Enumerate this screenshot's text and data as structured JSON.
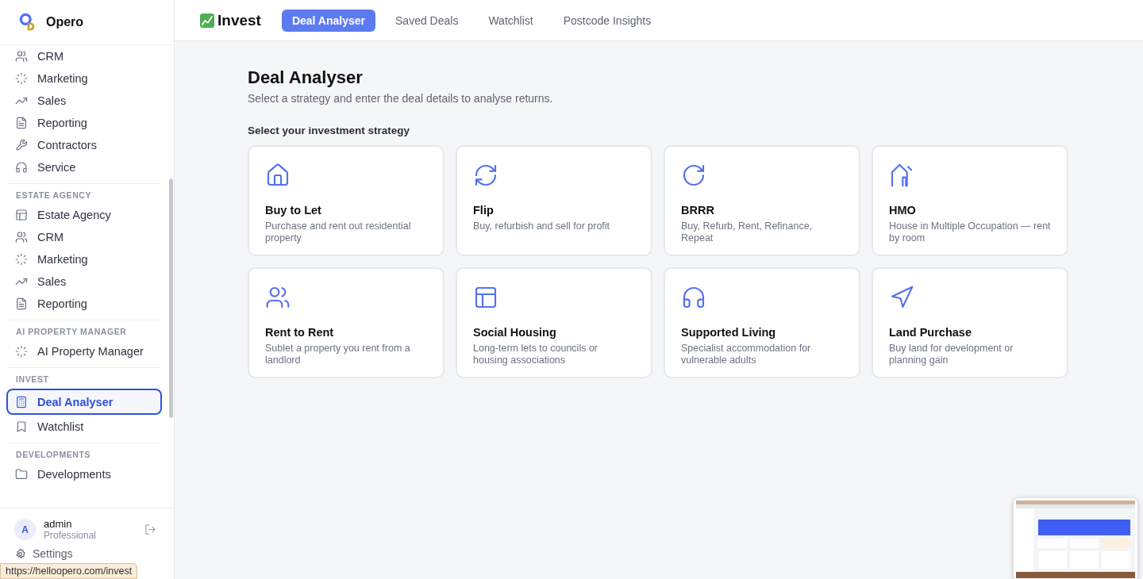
{
  "app": {
    "name": "Opero"
  },
  "sidebar": {
    "sections": [
      {
        "items": [
          {
            "label": "CRM",
            "selected": false
          },
          {
            "label": "Marketing",
            "selected": false
          },
          {
            "label": "Sales",
            "selected": false
          },
          {
            "label": "Reporting",
            "selected": false
          },
          {
            "label": "Contractors",
            "selected": false
          },
          {
            "label": "Service",
            "selected": false
          }
        ]
      },
      {
        "heading": "ESTATE AGENCY",
        "items": [
          {
            "label": "Estate Agency",
            "selected": false
          },
          {
            "label": "CRM",
            "selected": false
          },
          {
            "label": "Marketing",
            "selected": false
          },
          {
            "label": "Sales",
            "selected": false
          },
          {
            "label": "Reporting",
            "selected": false
          }
        ]
      },
      {
        "heading": "AI PROPERTY MANAGER",
        "items": [
          {
            "label": "AI Property Manager",
            "selected": false
          }
        ]
      },
      {
        "heading": "INVEST",
        "items": [
          {
            "label": "Deal Analyser",
            "selected": true
          },
          {
            "label": "Watchlist",
            "selected": false
          }
        ]
      },
      {
        "heading": "DEVELOPMENTS",
        "items": [
          {
            "label": "Developments",
            "selected": false
          }
        ]
      }
    ],
    "user": {
      "avatar": "A",
      "name": "admin",
      "plan": "Professional"
    },
    "settings": "Settings"
  },
  "header": {
    "title": "Invest",
    "tabs": [
      {
        "label": "Deal Analyser",
        "selected": true
      },
      {
        "label": "Saved Deals",
        "selected": false
      },
      {
        "label": "Watchlist",
        "selected": false
      },
      {
        "label": "Postcode Insights",
        "selected": false
      }
    ]
  },
  "page": {
    "title": "Deal Analyser",
    "subtitle": "Select a strategy and enter the deal details to analyse returns.",
    "section_label": "Select your investment strategy",
    "strategies": [
      {
        "title": "Buy to Let",
        "description": "Purchase and rent out residential property"
      },
      {
        "title": "Flip",
        "description": "Buy, refurbish and sell for profit"
      },
      {
        "title": "BRRR",
        "description": "Buy, Refurb, Rent, Refinance, Repeat"
      },
      {
        "title": "HMO",
        "description": "House in Multiple Occupation — rent by room"
      },
      {
        "title": "Rent to Rent",
        "description": "Sublet a property you rent from a landlord"
      },
      {
        "title": "Social Housing",
        "description": "Long-term lets to councils or housing associations"
      },
      {
        "title": "Supported Living",
        "description": "Specialist accommodation for vulnerable adults"
      },
      {
        "title": "Land Purchase",
        "description": "Buy land for development or planning gain"
      }
    ]
  },
  "status_url": "https://helloopero.com/invest"
}
